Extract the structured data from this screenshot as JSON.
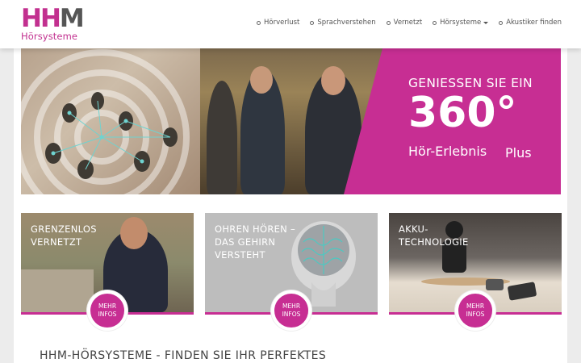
{
  "logo": {
    "letters_h1": "H",
    "letters_h2": "H",
    "letters_m": "M",
    "subtitle": "Hörsysteme"
  },
  "nav": [
    {
      "label": "Hörverlust"
    },
    {
      "label": "Sprachverstehen"
    },
    {
      "label": "Vernetzt"
    },
    {
      "label": "Hörsysteme"
    },
    {
      "label": "Akustiker finden"
    }
  ],
  "hero": {
    "line1": "GENIESSEN SIE EIN",
    "big": "360°",
    "plus": "Plus",
    "sub": "Hör-Erlebnis"
  },
  "cards": [
    {
      "title_1": "GRENZENLOS",
      "title_2": "VERNETZT",
      "title_3": "",
      "more_1": "MEHR",
      "more_2": "INFOS"
    },
    {
      "title_1": "OHREN HÖREN –",
      "title_2": "DAS GEHIRN",
      "title_3": "VERSTEHT",
      "more_1": "MEHR",
      "more_2": "INFOS"
    },
    {
      "title_1": "AKKU-",
      "title_2": "TECHNOLOGIE",
      "title_3": "",
      "more_1": "MEHR",
      "more_2": "INFOS"
    }
  ],
  "section_title": "HHM-HÖRSYSTEME - FINDEN SIE IHR PERFEKTES",
  "colors": {
    "brand": "#c72e93",
    "text": "#555555"
  }
}
